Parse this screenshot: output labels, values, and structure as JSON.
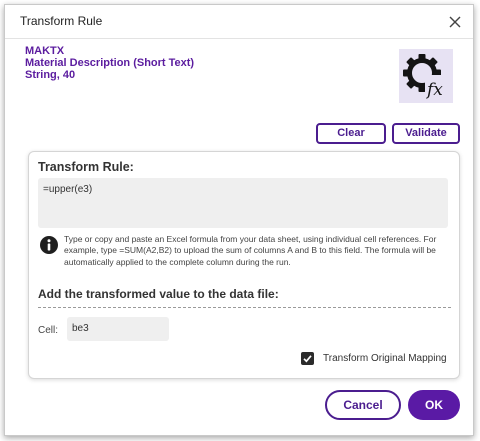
{
  "dialog": {
    "title": "Transform Rule"
  },
  "field": {
    "name": "MAKTX",
    "description": "Material Description (Short Text)",
    "type": "String, 40"
  },
  "toolbar": {
    "clear_label": "Clear",
    "validate_label": "Validate"
  },
  "rule": {
    "heading": "Transform Rule:",
    "formula": "=upper(e3)",
    "info_text": "Type or copy and paste an Excel formula from your data sheet, using individual cell references. For example, type =SUM(A2,B2) to upload the sum of columns A and B to this field. The formula will be automatically applied to the complete column during the run."
  },
  "transformed": {
    "heading": "Add the transformed value to the data file:",
    "cell_label": "Cell:",
    "cell_value": "be3"
  },
  "mapping": {
    "label": "Transform Original Mapping",
    "checked": true
  },
  "footer": {
    "cancel_label": "Cancel",
    "ok_label": "OK"
  },
  "colors": {
    "accent": "#4b1d8f",
    "primary_button": "#5a1aa5",
    "field_info": "#5b1c9f",
    "icon_background": "#e7e2f3"
  },
  "icons": {
    "close": "close-icon",
    "function": "gear-fx-icon",
    "info": "info-icon",
    "check": "checkmark-icon"
  }
}
